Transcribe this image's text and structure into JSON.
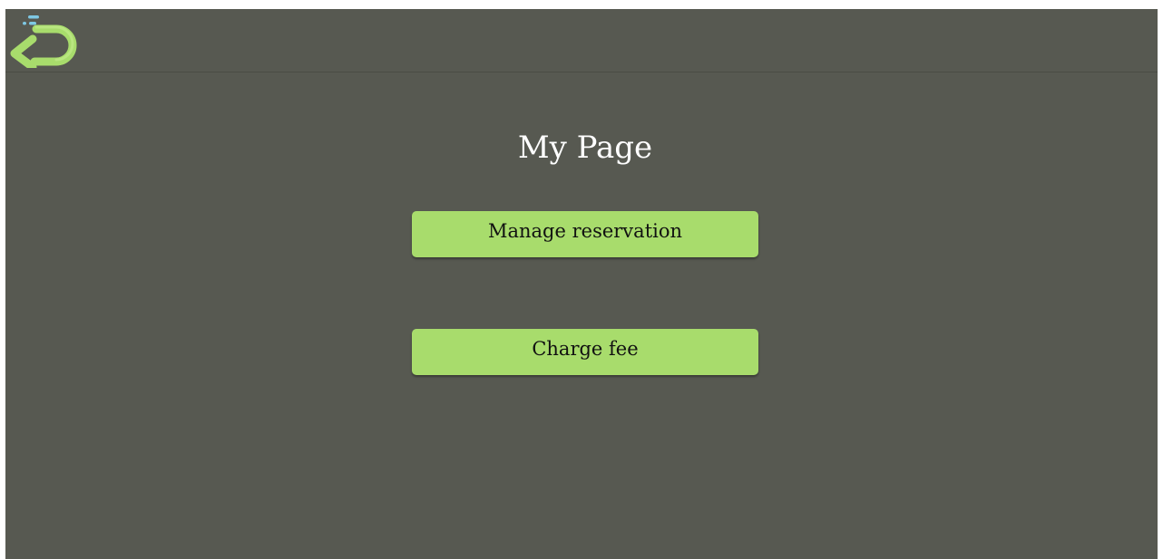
{
  "header": {
    "back_icon": "return-arrow-icon",
    "back_icon_color": "#a8dc6c",
    "accent_dots_color": "#7ec8e3"
  },
  "main": {
    "title": "My Page",
    "buttons": [
      {
        "label": "Manage reservation"
      },
      {
        "label": "Charge fee"
      }
    ]
  },
  "colors": {
    "background": "#575951",
    "button": "#a8dc6c",
    "title_text": "#ffffff",
    "button_text": "#111111"
  }
}
